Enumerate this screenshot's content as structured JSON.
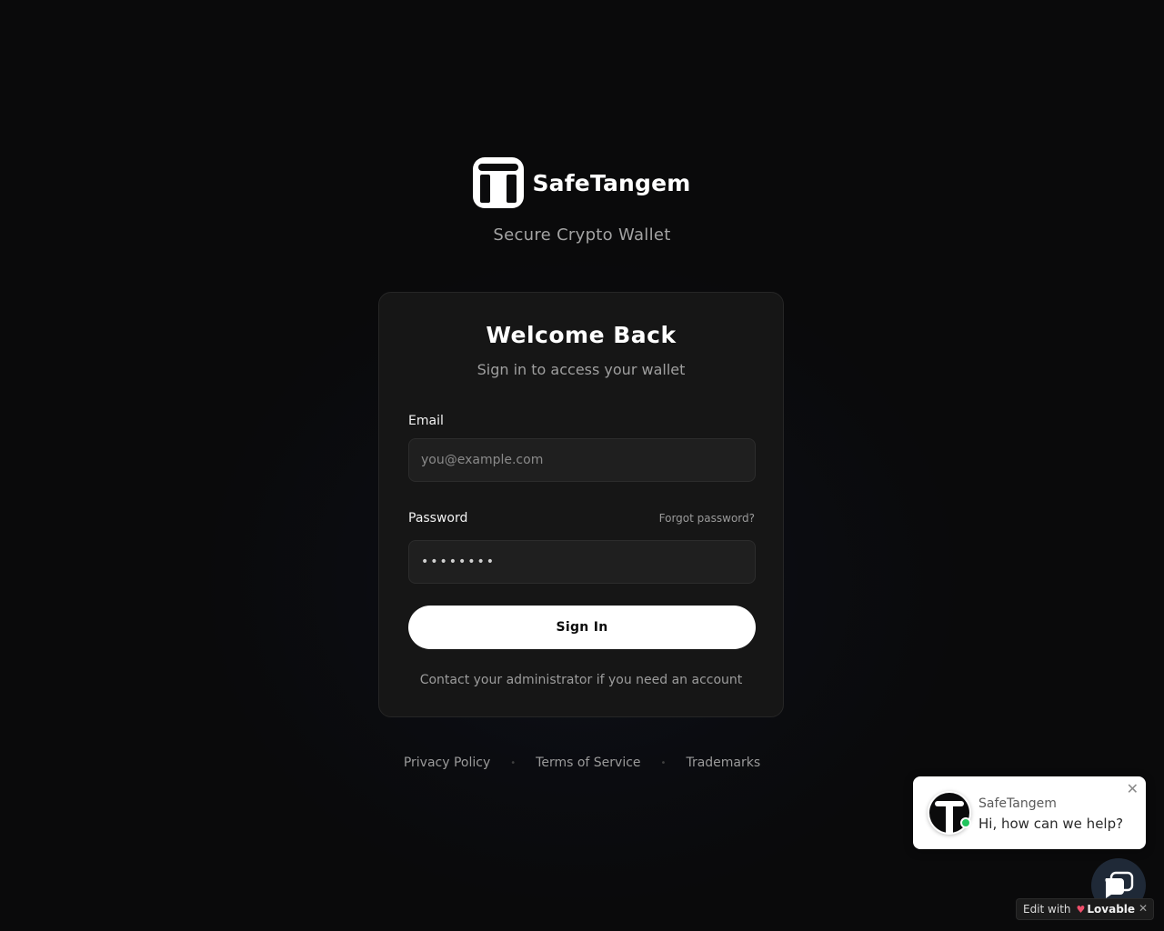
{
  "brand": {
    "name": "SafeTangem",
    "tagline": "Secure Crypto Wallet",
    "logo_icon": "safetangem-logo-icon"
  },
  "login": {
    "title": "Welcome Back",
    "subtitle": "Sign in to access your wallet",
    "email_label": "Email",
    "email_placeholder": "you@example.com",
    "password_label": "Password",
    "forgot_password": "Forgot password?",
    "password_value": "••••••••",
    "sign_in_label": "Sign In",
    "contact_text": "Contact your administrator if you need an account"
  },
  "footer": {
    "links": [
      "Privacy Policy",
      "Terms of Service",
      "Trademarks"
    ],
    "separator": "•"
  },
  "chat": {
    "name": "SafeTangem",
    "message": "Hi, how can we help?",
    "close_glyph": "✕",
    "status_color": "#22c55e"
  },
  "edit_badge": {
    "prefix": "Edit with",
    "brand": "Lovable",
    "close_glyph": "✕"
  },
  "colors": {
    "background": "#0b0b0c",
    "card": "#161616",
    "button": "#ffffff",
    "chat_launcher": "#1f2937"
  }
}
